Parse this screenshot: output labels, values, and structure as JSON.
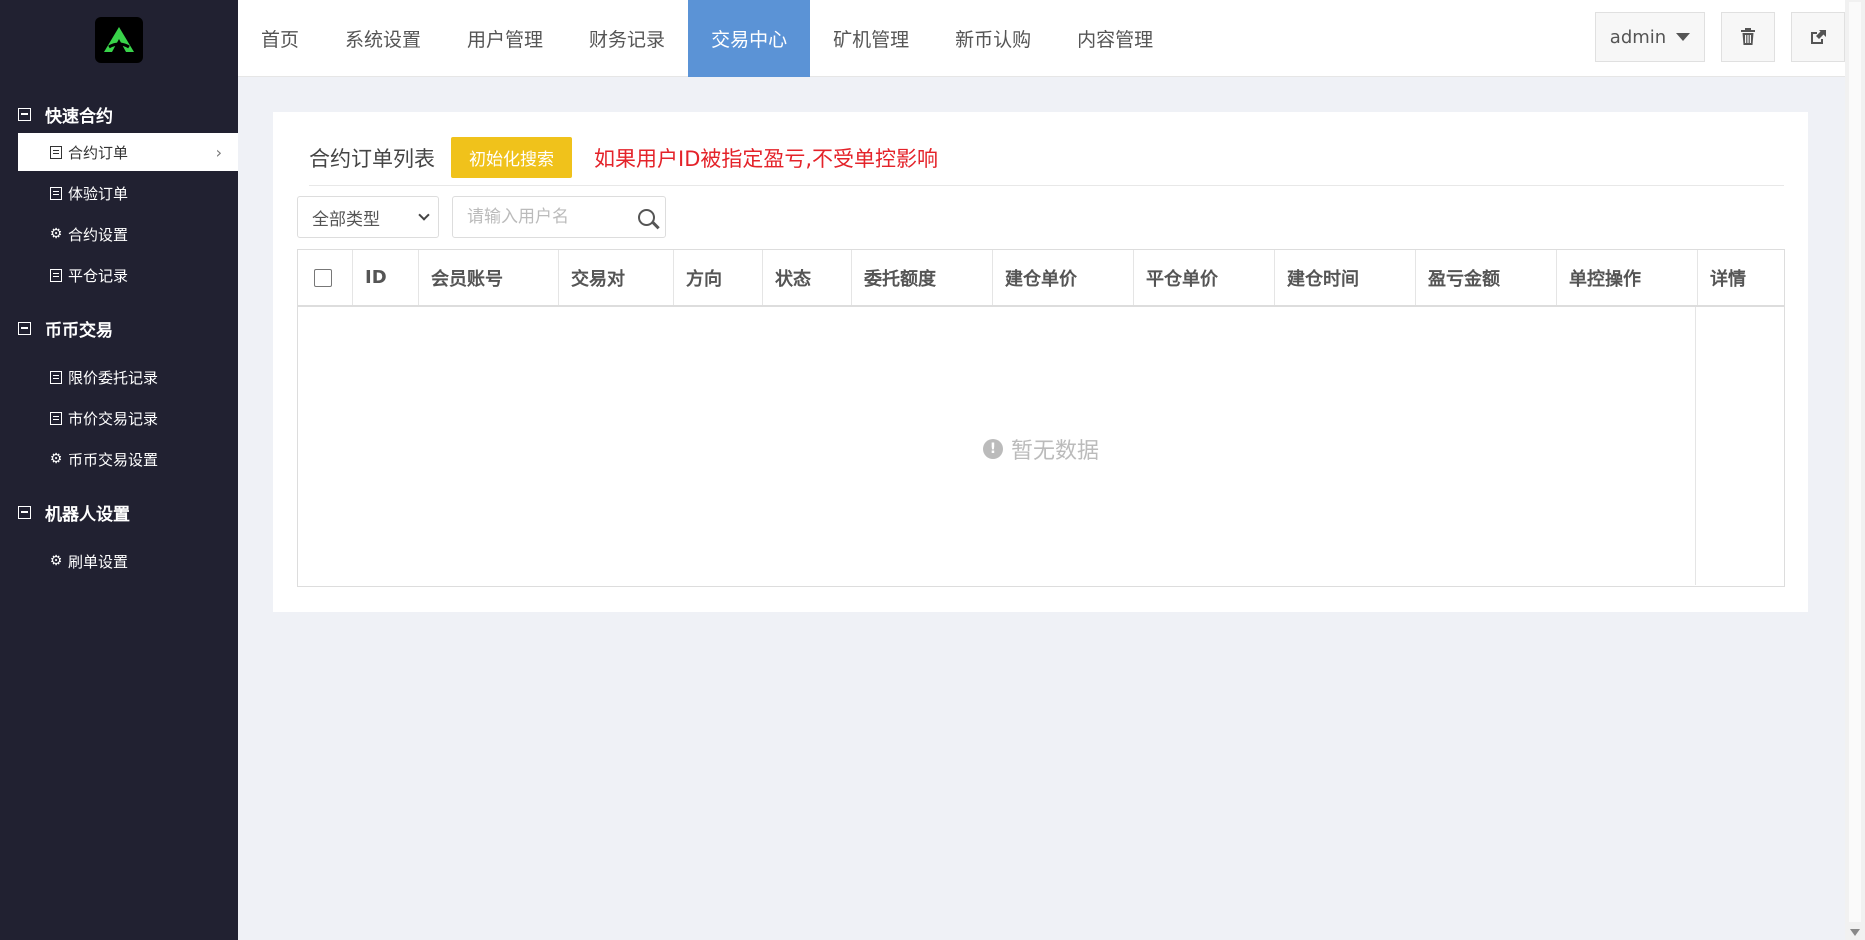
{
  "sidebar": {
    "groups": [
      {
        "title": "快速合约",
        "items": [
          {
            "label": "合约订单",
            "icon": "table-icon"
          },
          {
            "label": "体验订单",
            "icon": "table-icon"
          },
          {
            "label": "合约设置",
            "icon": "gear-icon"
          },
          {
            "label": "平仓记录",
            "icon": "table-icon"
          }
        ]
      },
      {
        "title": "币币交易",
        "items": [
          {
            "label": "限价委托记录",
            "icon": "table-icon"
          },
          {
            "label": "市价交易记录",
            "icon": "table-icon"
          },
          {
            "label": "币币交易设置",
            "icon": "gear-icon"
          }
        ]
      },
      {
        "title": "机器人设置",
        "items": [
          {
            "label": "刷单设置",
            "icon": "gear-icon"
          }
        ]
      }
    ],
    "active_item": "合约订单"
  },
  "nav": {
    "items": [
      "首页",
      "系统设置",
      "用户管理",
      "财务记录",
      "交易中心",
      "矿机管理",
      "新币认购",
      "内容管理"
    ],
    "active": "交易中心"
  },
  "topbar": {
    "user": "admin",
    "accent": "#5b93d6"
  },
  "panel": {
    "title": "合约订单列表",
    "init_button": "初始化搜索",
    "warning": "如果用户ID被指定盈亏,不受单控影响",
    "type_select": "全部类型",
    "search_placeholder": "请输入用户名"
  },
  "table": {
    "columns": [
      "ID",
      "会员账号",
      "交易对",
      "方向",
      "状态",
      "委托额度",
      "建仓单价",
      "平仓单价",
      "建仓时间",
      "盈亏金额",
      "单控操作",
      "详情"
    ],
    "empty_text": "暂无数据"
  }
}
